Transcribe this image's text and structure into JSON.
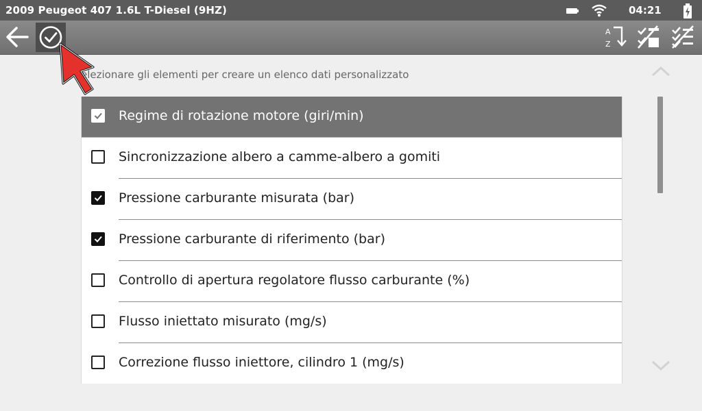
{
  "status_bar": {
    "vehicle": "2009 Peugeot 407 1.6L T-Diesel (9HZ)",
    "time": "04:21",
    "icons": [
      "battery-icon",
      "wifi-icon",
      "charging-icon"
    ]
  },
  "toolbar": {
    "icons": [
      "back-arrow-icon",
      "check-circle-icon",
      "sort-az-icon",
      "select-all-icon",
      "deselect-all-icon"
    ]
  },
  "instruction": "elezionare gli elementi per creare un elenco dati personalizzato",
  "scroll_icons": [
    "chevron-up-icon",
    "chevron-down-icon"
  ],
  "items": [
    {
      "label": "Regime di rotazione motore (giri/min)",
      "checked": true,
      "highlighted": true
    },
    {
      "label": "Sincronizzazione albero a camme-albero a gomiti",
      "checked": false
    },
    {
      "label": "Pressione carburante misurata (bar)",
      "checked": true
    },
    {
      "label": "Pressione carburante di riferimento (bar)",
      "checked": true
    },
    {
      "label": "Controllo di apertura regolatore flusso carburante (%)",
      "checked": false
    },
    {
      "label": "Flusso iniettato misurato (mg/s)",
      "checked": false
    },
    {
      "label": "Correzione flusso iniettore, cilindro 1 (mg/s)",
      "checked": false
    }
  ],
  "colors": {
    "status_bar": "#5b5b5b",
    "toolbar": "#7a7a7a",
    "highlight_row": "#737373",
    "pointer_arrow": "#e4312b"
  }
}
